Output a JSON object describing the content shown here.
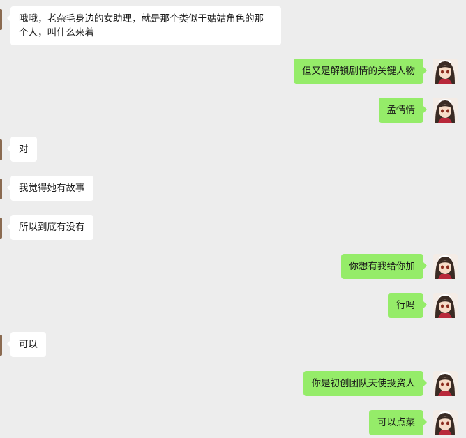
{
  "messages": [
    {
      "side": "left",
      "text": "哦哦，老杂毛身边的女助理，就是那个类似于姑姑角色的那个人，叫什么来着"
    },
    {
      "side": "right",
      "text": "但又是解锁剧情的关键人物"
    },
    {
      "side": "right",
      "text": "孟情情"
    },
    {
      "side": "left",
      "text": "对"
    },
    {
      "side": "left",
      "text": "我觉得她有故事"
    },
    {
      "side": "left",
      "text": "所以到底有没有"
    },
    {
      "side": "right",
      "text": "你想有我给你加"
    },
    {
      "side": "right",
      "text": "行吗"
    },
    {
      "side": "left",
      "text": "可以"
    },
    {
      "side": "right",
      "text": "你是初创团队天使投资人"
    },
    {
      "side": "right",
      "text": "可以点菜"
    }
  ],
  "colors": {
    "background": "#ededed",
    "incoming_bubble": "#ffffff",
    "outgoing_bubble": "#95ec69"
  },
  "icons": {
    "incoming_avatar": "avatar-icon",
    "outgoing_avatar": "anime-girl-avatar-icon"
  }
}
